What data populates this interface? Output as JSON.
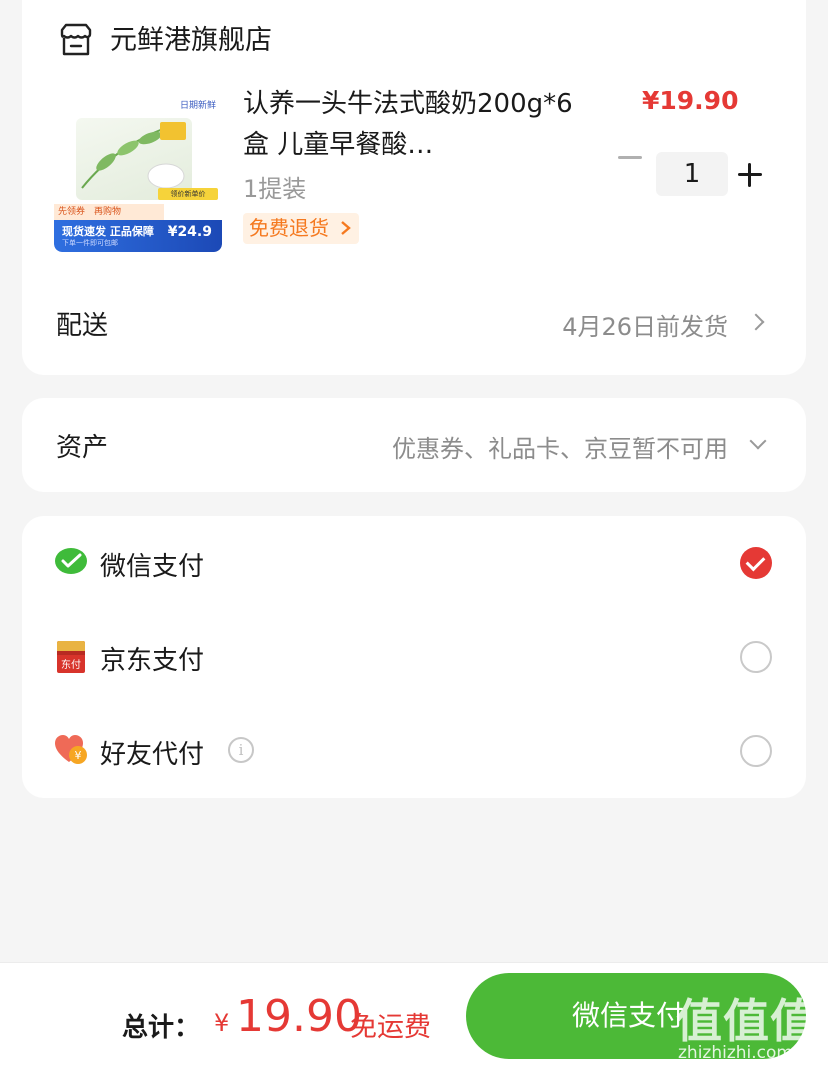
{
  "store": {
    "name": "元鲜港旗舰店",
    "icon": "store-icon"
  },
  "product": {
    "title": "认养一头牛法式酸奶200g*6盒 儿童早餐酸…",
    "spec": "1提装",
    "return_tag": "免费退货",
    "price": "¥19.90",
    "quantity": "1",
    "image": {
      "tag_top": "日期新鲜",
      "badge_left": "先领券　再购物",
      "blue_text": "现货速发 正品保障",
      "blue_sub": "下单一件即可包邮",
      "price_tag": "领价新单价",
      "price": "¥24.9"
    }
  },
  "delivery": {
    "label": "配送",
    "value": "4月26日前发货"
  },
  "assets": {
    "label": "资产",
    "value": "优惠券、礼品卡、京豆暂不可用"
  },
  "payment_methods": [
    {
      "label": "微信支付",
      "icon": "wechat-pay-icon",
      "selected": true
    },
    {
      "label": "京东支付",
      "icon": "jd-pay-icon",
      "selected": false
    },
    {
      "label": "好友代付",
      "icon": "friend-pay-icon",
      "selected": false,
      "info_icon": "info-icon",
      "info_glyph": "i"
    }
  ],
  "bottom_bar": {
    "total_label": "总计：",
    "currency": "¥",
    "total_amount": "19.90",
    "shipping": "免运费",
    "pay_button": "微信支付"
  },
  "watermark": {
    "text": "值值值",
    "url": "zhizhizhi.com"
  },
  "colors": {
    "accent_red": "#e53935",
    "wechat_green": "#4cb937",
    "return_orange": "#f5791f"
  }
}
